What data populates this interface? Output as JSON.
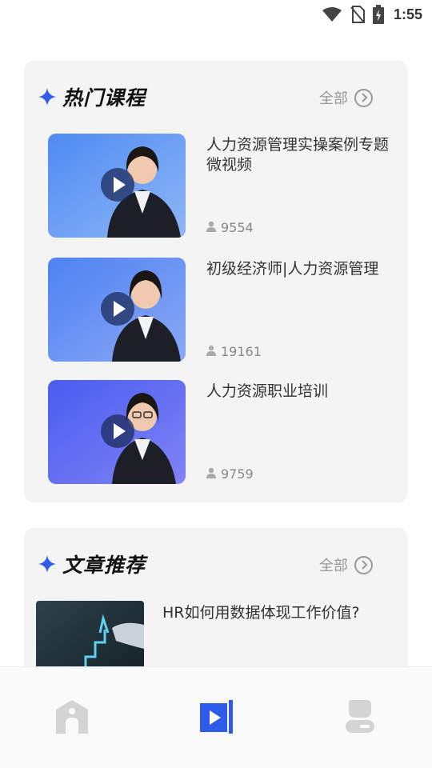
{
  "status_bar": {
    "time": "1:55",
    "icons": [
      "wifi-icon",
      "no-sim-icon",
      "battery-charging-icon"
    ]
  },
  "hot_courses": {
    "title": "热门课程",
    "more_label": "全部",
    "items": [
      {
        "title": "人力资源管理实操案例专题微视频",
        "count": "9554"
      },
      {
        "title": "初级经济师|人力资源管理",
        "count": "19161"
      },
      {
        "title": "人力资源职业培训",
        "count": "9759"
      }
    ]
  },
  "articles": {
    "title": "文章推荐",
    "more_label": "全部",
    "items": [
      {
        "title": "HR如何用数据体现工作价值?"
      }
    ]
  },
  "bottom_nav": {
    "items": [
      "home-icon",
      "video-icon",
      "profile-icon"
    ],
    "active_index": 1
  },
  "colors": {
    "accent": "#2f5bea",
    "card_bg": "#f4f4f4",
    "inactive_icon": "#d4d4d4"
  }
}
